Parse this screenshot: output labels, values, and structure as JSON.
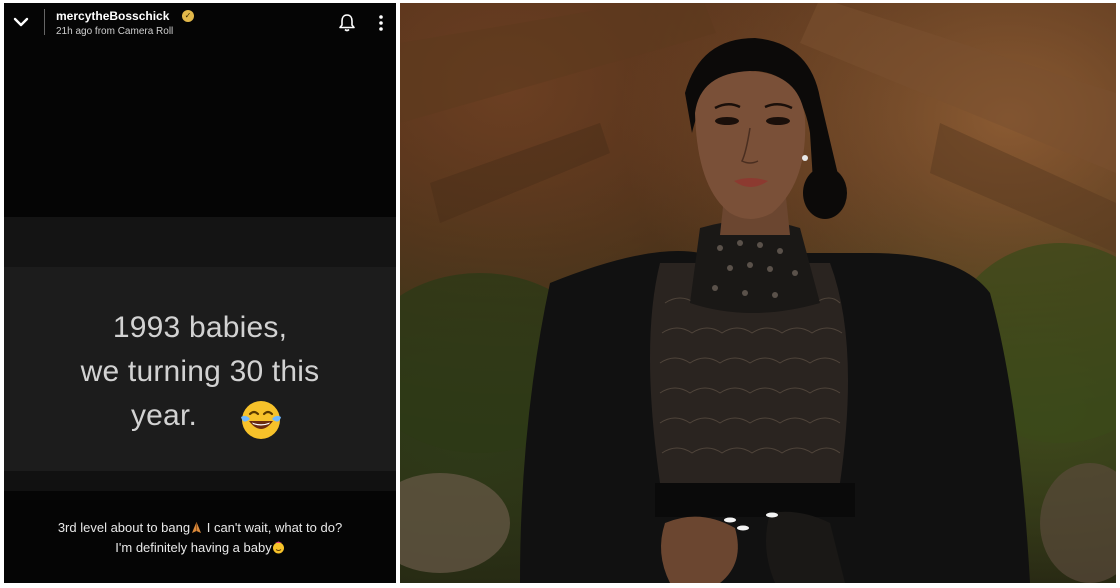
{
  "story": {
    "username": "mercytheBosschick",
    "subtitle": "21h ago from Camera Roll",
    "card_lines": [
      "1993 babies,",
      "we turning 30 this",
      "year."
    ],
    "caption_line1": "3rd level about to bang",
    "caption_line1_tail": " I can't wait, what to do?",
    "caption_line2": "I'm definitely having a baby"
  },
  "icons": {
    "collapse": "chevron-down-icon",
    "verified": "verified-badge-icon",
    "notify": "bell-icon",
    "menu": "more-vertical-icon",
    "laugh": "laughing-tears-emoji",
    "pray": "praying-hands-emoji",
    "party": "party-face-emoji"
  },
  "colors": {
    "story_bg": "#050505",
    "card_bg": "#1c1c1c",
    "text_light": "#d2d2d2",
    "verified": "#e2b84a"
  }
}
